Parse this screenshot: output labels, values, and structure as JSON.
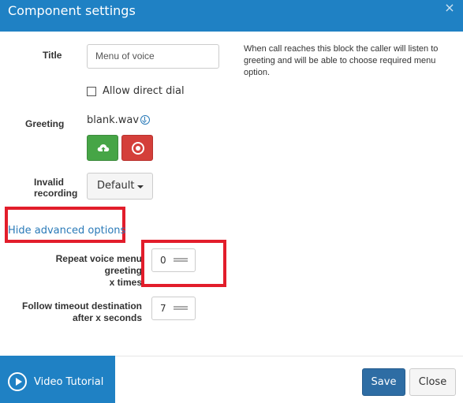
{
  "header": {
    "title": "Component settings",
    "close_icon": "close-icon",
    "close_glyph": "×"
  },
  "form": {
    "title_label": "Title",
    "title_value": "Menu of voice",
    "help_text": "When call reaches this block the caller will listen to greeting and will be able to choose required menu option.",
    "allow_direct_dial_label": "Allow direct dial",
    "allow_direct_dial_checked": false,
    "greeting_label": "Greeting",
    "greeting_file": "blank.wav",
    "upload_icon": "upload-cloud-icon",
    "record_icon": "record-icon",
    "invalid_recording_label_1": "Invalid",
    "invalid_recording_label_2": "recording",
    "invalid_recording_value": "Default",
    "advanced_toggle": "Hide advanced options",
    "repeat_label_1": "Repeat voice menu greeting",
    "repeat_label_2": "x times",
    "repeat_value": "0",
    "follow_label_1": "Follow timeout destination",
    "follow_label_2": "after x seconds",
    "follow_value": "7"
  },
  "footer": {
    "video_tutorial": "Video Tutorial",
    "play_icon": "play-circle-icon",
    "save": "Save",
    "close": "Close"
  },
  "colors": {
    "header": "#1f81c4",
    "success": "#46a546",
    "danger": "#d43f3a",
    "primary": "#2e6da4",
    "annotation": "#e21d2b"
  }
}
